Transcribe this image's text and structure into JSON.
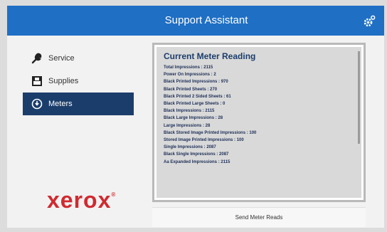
{
  "header": {
    "title": "Support Assistant"
  },
  "sidebar": {
    "items": [
      {
        "label": "Service",
        "icon": "wrench-icon",
        "active": false
      },
      {
        "label": "Supplies",
        "icon": "supplies-icon",
        "active": false
      },
      {
        "label": "Meters",
        "icon": "meter-icon",
        "active": true
      }
    ]
  },
  "brand": {
    "logo_text": "xerox",
    "color": "#d12a2f"
  },
  "meter_panel": {
    "title": "Current Meter Reading",
    "readings": [
      "Total Impressions : 2115",
      "Power On Impressions : 2",
      "Black Printed Impressions : 970",
      "Black Printed Sheets : 270",
      "Black Printed 2 Sided Sheets : 61",
      "Black Printed Large Sheets : 0",
      "Black Impressions : 2115",
      "Black Large Impressions : 28",
      "Large Impressions : 28",
      "Black Stored Image Printed Impressions : 100",
      "Stored Image Printed Impressions : 100",
      "Single Impressions : 2087",
      "Black Single Impressions : 2087",
      "Aa Expanded Impressions : 2115"
    ]
  },
  "actions": {
    "send_label": "Send Meter Reads"
  },
  "colors": {
    "header": "#1f6fc4",
    "nav_active": "#1b3d6b"
  }
}
